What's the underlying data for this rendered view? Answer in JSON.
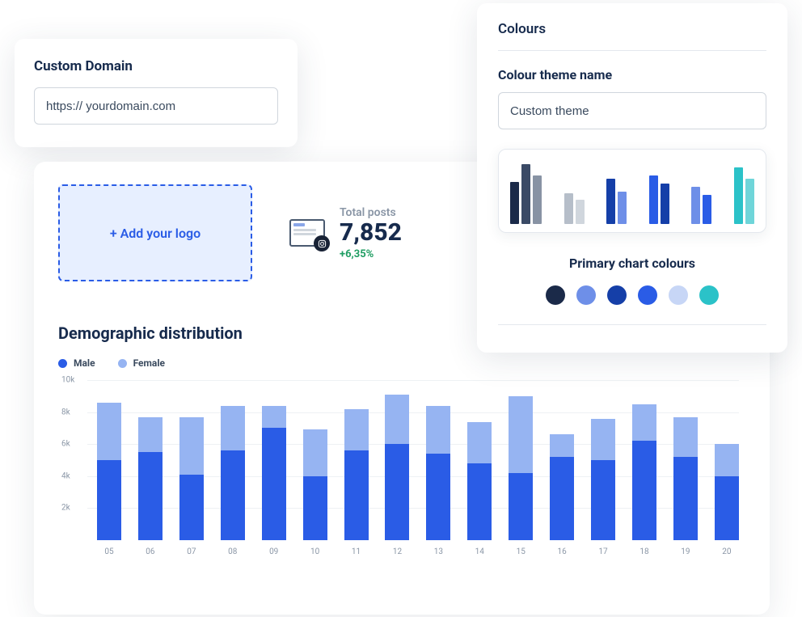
{
  "domain_card": {
    "title": "Custom Domain",
    "value": "https:// yourdomain.com"
  },
  "logo_label": "+ Add your logo",
  "posts": {
    "label": "Total posts",
    "value": "7,852",
    "delta": "+6,35%"
  },
  "colours_panel": {
    "heading": "Colours",
    "theme_label": "Colour theme name",
    "theme_value": "Custom theme",
    "primary_label": "Primary chart colours",
    "swatches": [
      "#1b2a49",
      "#6e8fe8",
      "#153fa8",
      "#2a5ce6",
      "#c7d6f6",
      "#2bc2c8"
    ],
    "scheme_groups": [
      [
        {
          "h": 52,
          "c": "#1b2a49"
        },
        {
          "h": 74,
          "c": "#3a4a66"
        },
        {
          "h": 60,
          "c": "#8893a4"
        }
      ],
      [
        {
          "h": 38,
          "c": "#b6bec9"
        },
        {
          "h": 30,
          "c": "#d0d6dd"
        }
      ],
      [
        {
          "h": 56,
          "c": "#153fa8"
        },
        {
          "h": 40,
          "c": "#6e8fe8"
        }
      ],
      [
        {
          "h": 60,
          "c": "#2a5ce6"
        },
        {
          "h": 50,
          "c": "#153fa8"
        }
      ],
      [
        {
          "h": 46,
          "c": "#6e8fe8"
        },
        {
          "h": 36,
          "c": "#2a5ce6"
        }
      ],
      [
        {
          "h": 70,
          "c": "#2bc2c8"
        },
        {
          "h": 56,
          "c": "#6fd5d9"
        }
      ]
    ]
  },
  "demo": {
    "title": "Demographic distribution",
    "legend": {
      "male": "Male",
      "female": "Female"
    },
    "colors": {
      "male": "#2a5ce6",
      "female": "#96b4f2"
    }
  },
  "chart_data": {
    "type": "bar",
    "stacked": true,
    "title": "Demographic distribution",
    "xlabel": "",
    "ylabel": "",
    "ylim": [
      0,
      10000
    ],
    "y_ticks": [
      "2k",
      "4k",
      "6k",
      "8k",
      "10k"
    ],
    "categories": [
      "05",
      "06",
      "07",
      "08",
      "09",
      "10",
      "11",
      "12",
      "13",
      "14",
      "15",
      "16",
      "17",
      "18",
      "19",
      "20"
    ],
    "series": [
      {
        "name": "Male",
        "color": "#2a5ce6",
        "values": [
          5000,
          5500,
          4100,
          5600,
          7000,
          4000,
          5600,
          6000,
          5400,
          4800,
          4200,
          5200,
          5000,
          6200,
          5200,
          4000
        ]
      },
      {
        "name": "Female",
        "color": "#96b4f2",
        "values": [
          3600,
          2200,
          3600,
          2800,
          1400,
          2900,
          2600,
          3100,
          3000,
          2600,
          4800,
          1400,
          2600,
          2300,
          2500,
          2000
        ]
      }
    ]
  }
}
